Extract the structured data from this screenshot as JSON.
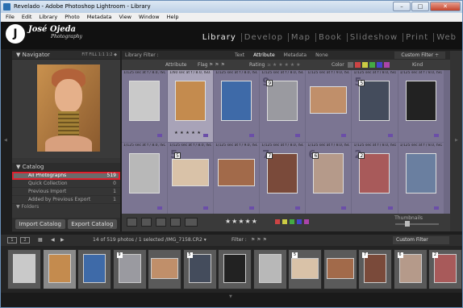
{
  "window": {
    "title": "Revelado - Adobe Photoshop Lightroom - Library",
    "min": "–",
    "max": "□",
    "close": "✕"
  },
  "menu": [
    "File",
    "Edit",
    "Library",
    "Photo",
    "Metadata",
    "View",
    "Window",
    "Help"
  ],
  "identity": {
    "logo_letter": "J",
    "name": "José Ojeda",
    "tagline": "Photography"
  },
  "modules": [
    {
      "label": "Library",
      "active": true
    },
    {
      "label": "Develop"
    },
    {
      "label": "Map"
    },
    {
      "label": "Book"
    },
    {
      "label": "Slideshow"
    },
    {
      "label": "Print"
    },
    {
      "label": "Web"
    }
  ],
  "navigator": {
    "title": "Navigator",
    "options": "FIT   FILL   1:1   1:2 ◆"
  },
  "catalog": {
    "title": "Catalog",
    "items": [
      {
        "label": "All Photographs",
        "count": "519",
        "selected": true
      },
      {
        "label": "Quick Collection",
        "count": "0"
      },
      {
        "label": "Previous Import",
        "count": "1"
      },
      {
        "label": "Added by Previous Export",
        "count": "1"
      }
    ]
  },
  "folders": {
    "title": "Folders"
  },
  "left_buttons": {
    "import": "Import Catalog",
    "export": "Export Catalog"
  },
  "library_filter": {
    "label": "Library Filter :",
    "tabs": [
      "Text",
      "Attribute",
      "Metadata",
      "None"
    ],
    "active_tab": "Attribute",
    "custom_filter": "Custom Filter ÷"
  },
  "attribute_bar": {
    "attribute": "Attribute",
    "flag": "Flag",
    "rating": "Rating",
    "color": "Color",
    "kind": "Kind"
  },
  "color_labels": [
    "#6a6a6a",
    "#c44",
    "#cc4",
    "#4a4",
    "#44c",
    "#a4a"
  ],
  "grid_cells": [
    {
      "hdr": "1/125 sec at f / 8.0, ISO...",
      "num": "",
      "badge": "",
      "tone": "#c9c9c9",
      "land": false,
      "stars": ""
    },
    {
      "hdr": "1/60 sec at f / 8.0, ISO...",
      "num": "",
      "badge": "",
      "tone": "#c48b4e",
      "land": false,
      "stars": "★ ★ ★ ★ ★",
      "selected": true
    },
    {
      "hdr": "1/125 sec at f / 8.0, ISO...",
      "num": "",
      "badge": "",
      "tone": "#3e6aa8",
      "land": false,
      "stars": ""
    },
    {
      "hdr": "1/125 sec at f / 8.0, ISO...",
      "num": "9",
      "badge": "9",
      "tone": "#9a9aa0",
      "land": false,
      "stars": ""
    },
    {
      "hdr": "1/125 sec at f / 9.0, ISO...",
      "num": "",
      "badge": "",
      "tone": "#c08f6a",
      "land": true,
      "stars": ""
    },
    {
      "hdr": "1/125 sec at f / 8.0, ISO...",
      "num": "5",
      "badge": "5",
      "tone": "#444c5c",
      "land": false,
      "stars": ""
    },
    {
      "hdr": "1/125 sec at f / 8.0, ISO...",
      "num": "",
      "badge": "",
      "tone": "#222",
      "land": false,
      "stars": ""
    },
    {
      "hdr": "1/125 sec at f / 8.0, ISO...",
      "num": "",
      "badge": "",
      "tone": "#b8b8b8",
      "land": false,
      "stars": ""
    },
    {
      "hdr": "1/125 sec at f / 8.0, ISO...",
      "num": "5",
      "badge": "5",
      "tone": "#d9c2a8",
      "land": true,
      "stars": ""
    },
    {
      "hdr": "1/125 sec at f / 9.0, ISO...",
      "num": "",
      "badge": "",
      "tone": "#a26a4a",
      "land": true,
      "stars": ""
    },
    {
      "hdr": "1/125 sec at f / 8.0, ISO...",
      "num": "7",
      "badge": "7",
      "tone": "#7a4a3a",
      "land": false,
      "stars": ""
    },
    {
      "hdr": "1/125 sec at f / 8.0, ISO...",
      "num": "6",
      "badge": "6",
      "tone": "#b59a8a",
      "land": false,
      "stars": ""
    },
    {
      "hdr": "1/125 sec at f / 8.0, ISO...",
      "num": "2",
      "badge": "2",
      "tone": "#a85a5a",
      "land": false,
      "stars": ""
    },
    {
      "hdr": "1/125 sec at f / 8.0, ISO...",
      "num": "",
      "badge": "",
      "tone": "#6a7fa0",
      "land": false,
      "stars": ""
    }
  ],
  "bottom_toolbar": {
    "stars": "★★★★★",
    "thumbnails": "Thumbnails"
  },
  "filmstrip_bar": {
    "page1": "1",
    "page2": "2",
    "info": "14 of 519 photos / 1 selected /IMG_7158.CR2 ▾",
    "filter_label": "Filter :",
    "custom_filter": "Custom Filter"
  },
  "filmstrip": [
    {
      "tone": "#c9c9c9",
      "land": false,
      "badge": ""
    },
    {
      "tone": "#c48b4e",
      "land": false,
      "badge": "",
      "selected": true
    },
    {
      "tone": "#3e6aa8",
      "land": false,
      "badge": ""
    },
    {
      "tone": "#9a9aa0",
      "land": false,
      "badge": "9"
    },
    {
      "tone": "#c08f6a",
      "land": true,
      "badge": ""
    },
    {
      "tone": "#444c5c",
      "land": false,
      "badge": "5"
    },
    {
      "tone": "#222",
      "land": false,
      "badge": ""
    },
    {
      "tone": "#b8b8b8",
      "land": false,
      "badge": ""
    },
    {
      "tone": "#d9c2a8",
      "land": true,
      "badge": "5"
    },
    {
      "tone": "#a26a4a",
      "land": true,
      "badge": ""
    },
    {
      "tone": "#7a4a3a",
      "land": false,
      "badge": "7"
    },
    {
      "tone": "#b59a8a",
      "land": false,
      "badge": "6"
    },
    {
      "tone": "#a85a5a",
      "land": false,
      "badge": "2"
    }
  ]
}
